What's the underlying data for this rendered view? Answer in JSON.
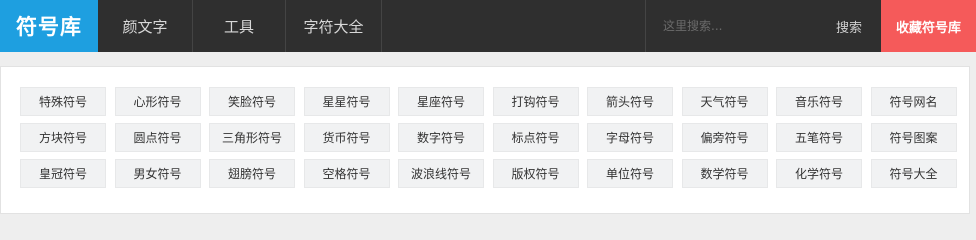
{
  "header": {
    "logo": "符号库",
    "nav": [
      "颜文字",
      "工具",
      "字符大全"
    ],
    "search_placeholder": "这里搜索...",
    "search_button": "搜索",
    "favorite_button": "收藏符号库"
  },
  "categories": [
    "特殊符号",
    "心形符号",
    "笑脸符号",
    "星星符号",
    "星座符号",
    "打钩符号",
    "箭头符号",
    "天气符号",
    "音乐符号",
    "符号网名",
    "方块符号",
    "圆点符号",
    "三角形符号",
    "货币符号",
    "数字符号",
    "标点符号",
    "字母符号",
    "偏旁符号",
    "五笔符号",
    "符号图案",
    "皇冠符号",
    "男女符号",
    "翅膀符号",
    "空格符号",
    "波浪线符号",
    "版权符号",
    "单位符号",
    "数学符号",
    "化学符号",
    "符号大全"
  ],
  "colors": {
    "logo_bg": "#1e9fe0",
    "topbar_bg": "#2f2f2f",
    "favorite_bg": "#f55a5a"
  }
}
